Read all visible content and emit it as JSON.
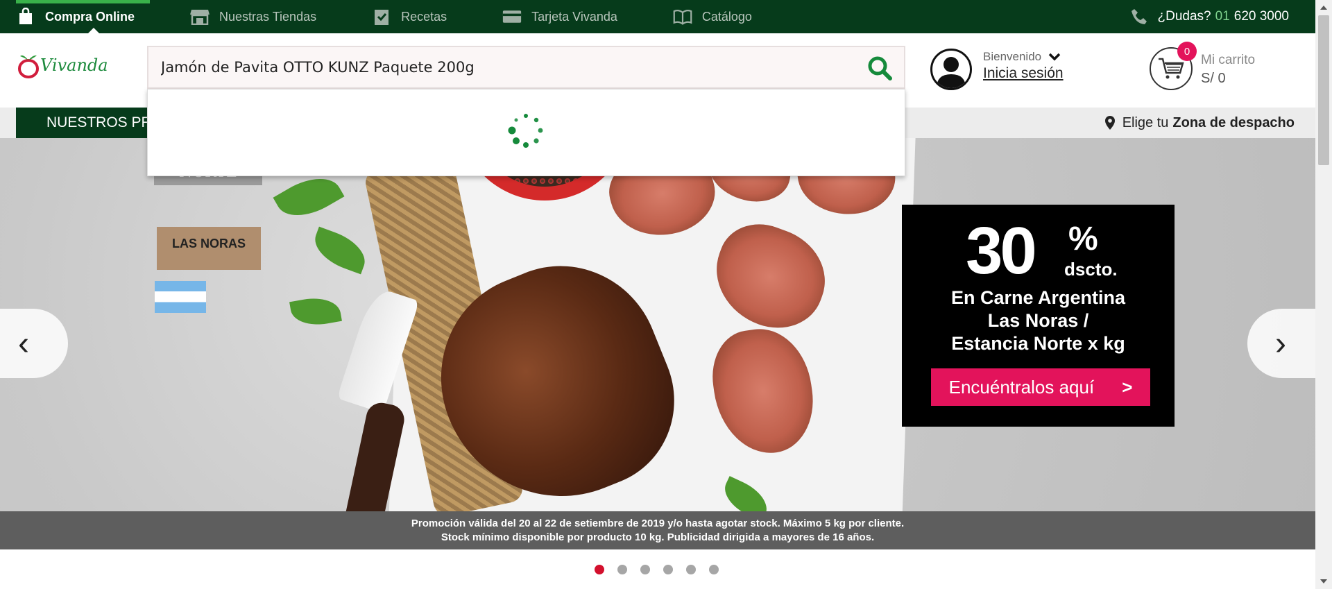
{
  "topnav": {
    "items": [
      {
        "label": "Compra Online",
        "icon": "shopping-bag-icon",
        "active": true
      },
      {
        "label": "Nuestras Tiendas",
        "icon": "store-icon",
        "active": false
      },
      {
        "label": "Recetas",
        "icon": "checklist-icon",
        "active": false
      },
      {
        "label": "Tarjeta Vivanda",
        "icon": "credit-card-icon",
        "active": false
      },
      {
        "label": "Catálogo",
        "icon": "open-book-icon",
        "active": false
      }
    ],
    "help": {
      "question": "¿Dudas?",
      "prefix": "01",
      "number": "620 3000"
    }
  },
  "header": {
    "logo_text": "Vivanda",
    "search": {
      "value": "Jamón de Pavita OTTO KUNZ Paquete 200g",
      "placeholder": ""
    },
    "user": {
      "welcome": "Bienvenido",
      "login": "Inicia sesión"
    },
    "cart": {
      "count": "0",
      "label": "Mi carrito",
      "total": "S/ 0"
    }
  },
  "catbar": {
    "button_label": "NUESTROS PRODUCTOS",
    "zone_prefix": "Elige tu",
    "zone_bold": "Zona de despacho"
  },
  "banner": {
    "brand1": "ESTANCIA NORTE",
    "brand2": "LAS NORAS",
    "promo": {
      "percent": "30",
      "percent_symbol": "%",
      "dscto": "dscto.",
      "line1": "En Carne Argentina",
      "line2": "Las Noras /",
      "line3": "Estancia Norte x kg",
      "button": "Encuéntralos aquí",
      "button_arrow": ">"
    },
    "legal_line1": "Promoción válida del 20 al 22 de setiembre de 2019 y/o hasta agotar stock. Máximo 5 kg por cliente.",
    "legal_line2": "Stock mínimo disponible por producto 10 kg. Publicidad dirigida a mayores de 16 años.",
    "prev": "‹",
    "next": "›",
    "slides": 6,
    "active_slide": 0
  },
  "colors": {
    "dark_green": "#063b1b",
    "accent_green": "#39b24a",
    "pink": "#e3135b",
    "red_dot": "#d3102d"
  }
}
